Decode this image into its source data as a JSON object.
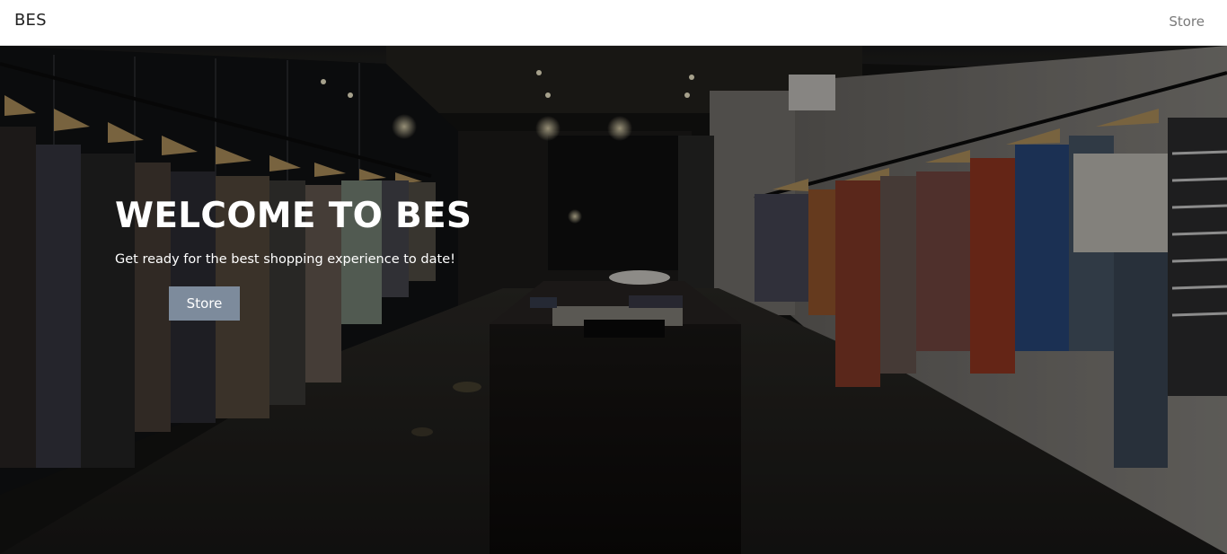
{
  "navbar": {
    "brand": "BES",
    "links": [
      {
        "label": "Store"
      }
    ]
  },
  "hero": {
    "title": "WELCOME TO BES",
    "subtitle": "Get ready for the best shopping experience to date!",
    "button_label": "Store",
    "background_image": "clothing-store-interior"
  },
  "colors": {
    "button": "#7d8b9c",
    "nav_link": "#7a7a7a",
    "brand": "#222222"
  }
}
